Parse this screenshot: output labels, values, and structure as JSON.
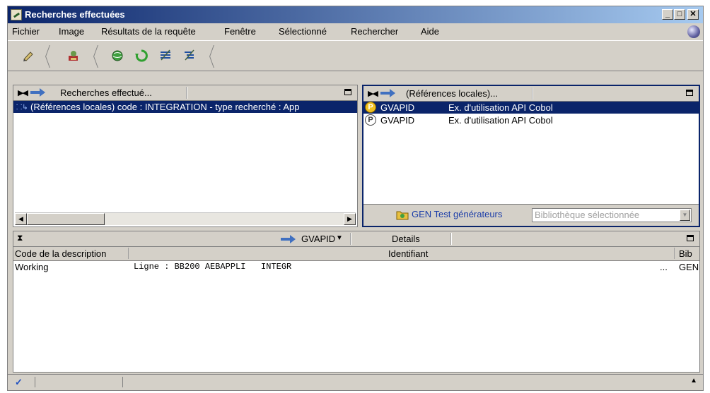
{
  "window": {
    "title": "Recherches effectuées"
  },
  "menu": [
    {
      "label": "Fichier"
    },
    {
      "label": "Image"
    },
    {
      "label": "Résultats de la requête"
    },
    {
      "label": "Fenêtre"
    },
    {
      "label": "Sélectionné"
    },
    {
      "label": "Rechercher"
    },
    {
      "label": "Aide"
    }
  ],
  "toolbar": {
    "icons": [
      "pencil-icon",
      "user-tool-icon",
      "globe-search-icon",
      "refresh-icon",
      "list-view-icon",
      "tree-view-icon"
    ]
  },
  "left_panel": {
    "header": "Recherches effectué...",
    "items": [
      {
        "text": "(Références locales) code : INTEGRATION - type recherché : App"
      }
    ]
  },
  "right_panel": {
    "header": "(Références locales)...",
    "items": [
      {
        "badge": "P",
        "code": "GVAPID",
        "description": "Ex. d'utilisation API Cobol"
      },
      {
        "badge": "P",
        "code": "GVAPID",
        "description": "Ex. d'utilisation API Cobol"
      }
    ],
    "footer": {
      "library_label": "GEN Test générateurs",
      "library_select_placeholder": "Bibliothèque sélectionnée"
    }
  },
  "bottom_panel": {
    "nav_label": "GVAPID",
    "details_tab": "Details",
    "columns": [
      "Code de la description",
      "Identifiant",
      "Bib"
    ],
    "rows": [
      {
        "code": "Working",
        "content": "Ligne : BB200 AEBAPPLI   INTEGR",
        "ellipsis": "...",
        "bib": "GEN"
      }
    ]
  },
  "colors": {
    "selection": "#0a246a",
    "title_start": "#0a246a",
    "title_end": "#a6caf0",
    "link": "#1a3ca8"
  }
}
